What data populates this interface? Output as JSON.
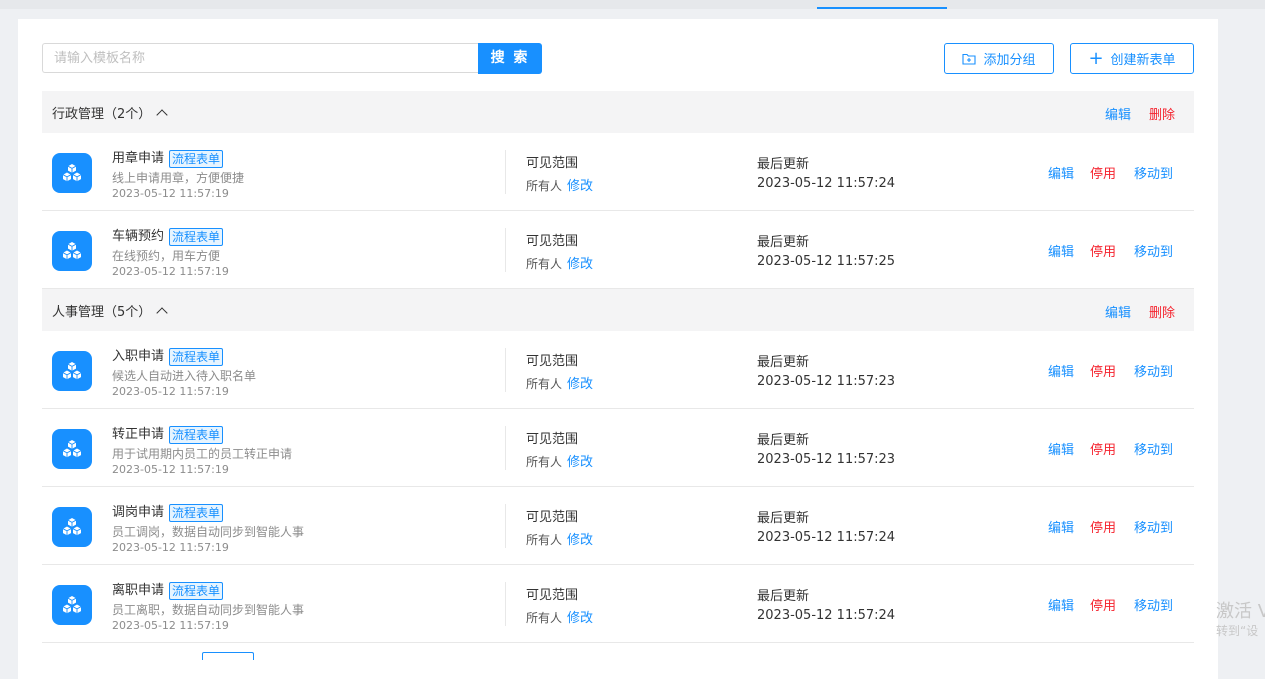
{
  "search": {
    "placeholder": "请输入模板名称",
    "button_label": "搜 索"
  },
  "toolbar": {
    "add_group_label": "添加分组",
    "create_form_label": "创建新表单"
  },
  "groups": [
    {
      "title": "行政管理（2个）",
      "edit_label": "编辑",
      "delete_label": "删除",
      "items": [
        {
          "name": "用章申请",
          "tag": "流程表单",
          "desc": "线上申请用章，方便便捷",
          "created": "2023-05-12 11:57:19",
          "visibility_label": "可见范围",
          "visibility_value": "所有人",
          "visibility_edit": "修改",
          "updated_label": "最后更新",
          "updated_value": "2023-05-12 11:57:24",
          "edit": "编辑",
          "stop": "停用",
          "move": "移动到"
        },
        {
          "name": "车辆预约",
          "tag": "流程表单",
          "desc": "在线预约，用车方便",
          "created": "2023-05-12 11:57:19",
          "visibility_label": "可见范围",
          "visibility_value": "所有人",
          "visibility_edit": "修改",
          "updated_label": "最后更新",
          "updated_value": "2023-05-12 11:57:25",
          "edit": "编辑",
          "stop": "停用",
          "move": "移动到"
        }
      ]
    },
    {
      "title": "人事管理（5个）",
      "edit_label": "编辑",
      "delete_label": "删除",
      "items": [
        {
          "name": "入职申请",
          "tag": "流程表单",
          "desc": "候选人自动进入待入职名单",
          "created": "2023-05-12 11:57:19",
          "visibility_label": "可见范围",
          "visibility_value": "所有人",
          "visibility_edit": "修改",
          "updated_label": "最后更新",
          "updated_value": "2023-05-12 11:57:23",
          "edit": "编辑",
          "stop": "停用",
          "move": "移动到"
        },
        {
          "name": "转正申请",
          "tag": "流程表单",
          "desc": "用于试用期内员工的员工转正申请",
          "created": "2023-05-12 11:57:19",
          "visibility_label": "可见范围",
          "visibility_value": "所有人",
          "visibility_edit": "修改",
          "updated_label": "最后更新",
          "updated_value": "2023-05-12 11:57:23",
          "edit": "编辑",
          "stop": "停用",
          "move": "移动到"
        },
        {
          "name": "调岗申请",
          "tag": "流程表单",
          "desc": "员工调岗，数据自动同步到智能人事",
          "created": "2023-05-12 11:57:19",
          "visibility_label": "可见范围",
          "visibility_value": "所有人",
          "visibility_edit": "修改",
          "updated_label": "最后更新",
          "updated_value": "2023-05-12 11:57:24",
          "edit": "编辑",
          "stop": "停用",
          "move": "移动到"
        },
        {
          "name": "离职申请",
          "tag": "流程表单",
          "desc": "员工离职，数据自动同步到智能人事",
          "created": "2023-05-12 11:57:19",
          "visibility_label": "可见范围",
          "visibility_value": "所有人",
          "visibility_edit": "修改",
          "updated_label": "最后更新",
          "updated_value": "2023-05-12 11:57:24",
          "edit": "编辑",
          "stop": "停用",
          "move": "移动到"
        }
      ]
    }
  ],
  "watermark": {
    "line1": "激活 V",
    "line2": "转到“设"
  },
  "colors": {
    "accent": "#1890ff",
    "danger": "#f5222d",
    "group_bg": "#f4f4f5"
  },
  "icons": {
    "app": "cubes-icon",
    "add_group": "folder-plus-icon",
    "create": "plus-icon",
    "collapse": "chevron-up-icon"
  }
}
